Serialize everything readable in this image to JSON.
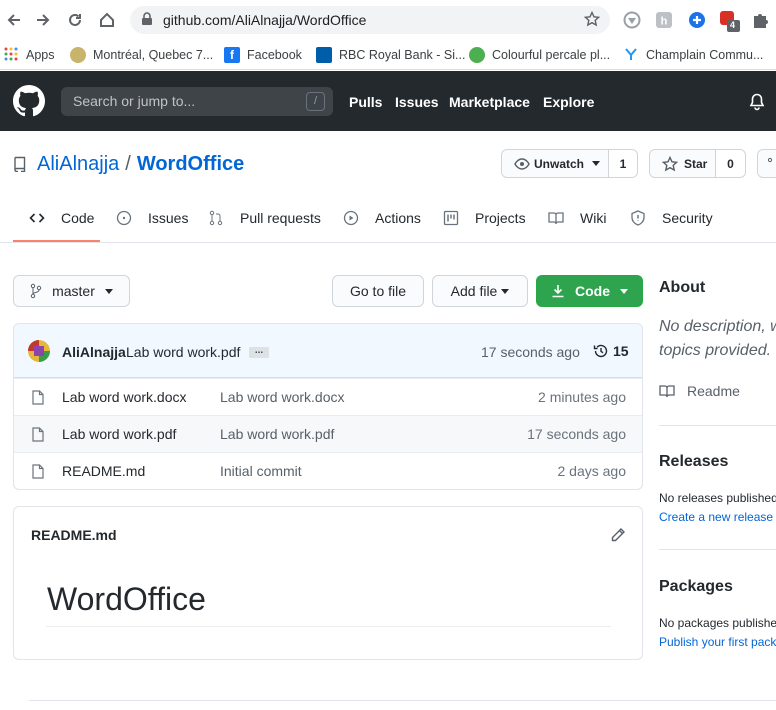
{
  "browser": {
    "url": "github.com/AliAlnajja/WordOffice",
    "extension_badge": "4",
    "bookmarks": [
      {
        "label": "Apps",
        "color": "#e8453c"
      },
      {
        "label": "Montréal, Quebec 7...",
        "color": "#c8b46a"
      },
      {
        "label": "Facebook",
        "color": "#1877f2"
      },
      {
        "label": "RBC Royal Bank - Si...",
        "color": "#005daa"
      },
      {
        "label": "Colourful percale pl...",
        "color": "#4caf50"
      },
      {
        "label": "Champlain Commu...",
        "color": "#2196f3"
      }
    ]
  },
  "header": {
    "search_placeholder": "Search or jump to...",
    "search_shortcut": "/",
    "nav": [
      "Pulls",
      "Issues",
      "Marketplace",
      "Explore"
    ]
  },
  "repo": {
    "owner": "AliAlnajja",
    "separator": "/",
    "name": "WordOffice",
    "watch_label": "Unwatch",
    "watch_count": "1",
    "star_label": "Star",
    "star_count": "0"
  },
  "tabs": [
    "Code",
    "Issues",
    "Pull requests",
    "Actions",
    "Projects",
    "Wiki",
    "Security"
  ],
  "toolbar": {
    "branch": "master",
    "go_to_file": "Go to file",
    "add_file": "Add file",
    "code": "Code"
  },
  "commit": {
    "author": "AliAlnajja",
    "message": "Lab word work.pdf",
    "ellipsis": "...",
    "time": "17 seconds ago",
    "commit_count": "15"
  },
  "files": [
    {
      "name": "Lab word work.docx",
      "message": "Lab word work.docx",
      "age": "2 minutes ago"
    },
    {
      "name": "Lab word work.pdf",
      "message": "Lab word work.pdf",
      "age": "17 seconds ago"
    },
    {
      "name": "README.md",
      "message": "Initial commit",
      "age": "2 days ago"
    }
  ],
  "readme": {
    "filename": "README.md",
    "heading": "WordOffice"
  },
  "sidebar": {
    "about_title": "About",
    "about_desc_line1": "No description, w",
    "about_desc_line2": "topics provided.",
    "readme_link": "Readme",
    "releases_title": "Releases",
    "releases_text": "No releases published",
    "releases_link": "Create a new release",
    "packages_title": "Packages",
    "packages_text": "No packages publishe",
    "packages_link": "Publish your first pack"
  },
  "colors": {
    "header_bg": "#24292e",
    "link": "#0366d6",
    "code_button": "#2ea44f",
    "tab_underline": "#f9826c",
    "commit_row_bg": "#f1f8ff"
  }
}
